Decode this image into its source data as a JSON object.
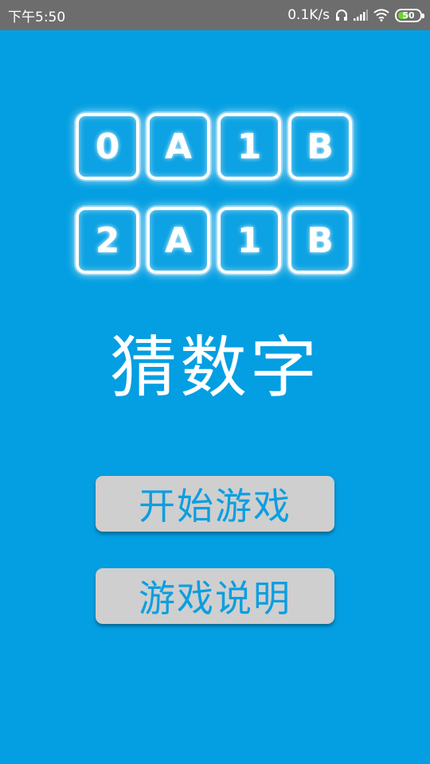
{
  "status_bar": {
    "time": "下午5:50",
    "net_speed": "0.1K/s",
    "battery_level": "50",
    "battery_fraction": 0.5,
    "icons": [
      "headphones-icon",
      "signal-icon",
      "wifi-icon",
      "battery-icon"
    ]
  },
  "logo": {
    "rows": [
      [
        "0",
        "A",
        "1",
        "B"
      ],
      [
        "2",
        "A",
        "1",
        "B"
      ]
    ]
  },
  "title": "猜数字",
  "buttons": {
    "start": "开始游戏",
    "help": "游戏说明"
  },
  "colors": {
    "background": "#039fe2",
    "status_bar": "#6d6d6d",
    "button_bg": "#cfcfcf",
    "button_text": "#0c9ee0",
    "battery_fill": "#6ed23a"
  }
}
